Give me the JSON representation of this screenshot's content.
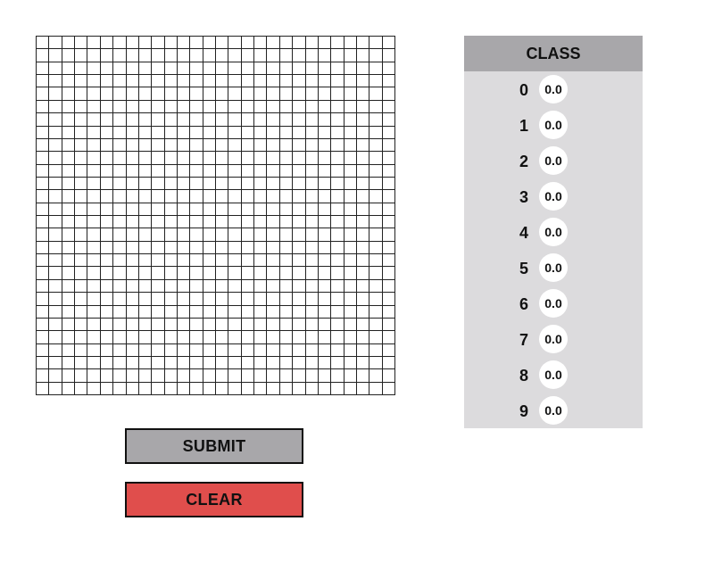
{
  "canvas": {
    "rows": 28,
    "cols": 28,
    "line_color": "#222222",
    "background": "#ffffff"
  },
  "buttons": {
    "submit_label": "SUBMIT",
    "clear_label": "CLEAR",
    "submit_color": "#a8a7aa",
    "clear_color": "#e04e4c"
  },
  "classes": {
    "header": "CLASS",
    "header_color": "#a8a7aa",
    "panel_color": "#dcdbdd",
    "items": [
      {
        "label": "0",
        "score": "0.0"
      },
      {
        "label": "1",
        "score": "0.0"
      },
      {
        "label": "2",
        "score": "0.0"
      },
      {
        "label": "3",
        "score": "0.0"
      },
      {
        "label": "4",
        "score": "0.0"
      },
      {
        "label": "5",
        "score": "0.0"
      },
      {
        "label": "6",
        "score": "0.0"
      },
      {
        "label": "7",
        "score": "0.0"
      },
      {
        "label": "8",
        "score": "0.0"
      },
      {
        "label": "9",
        "score": "0.0"
      }
    ]
  }
}
